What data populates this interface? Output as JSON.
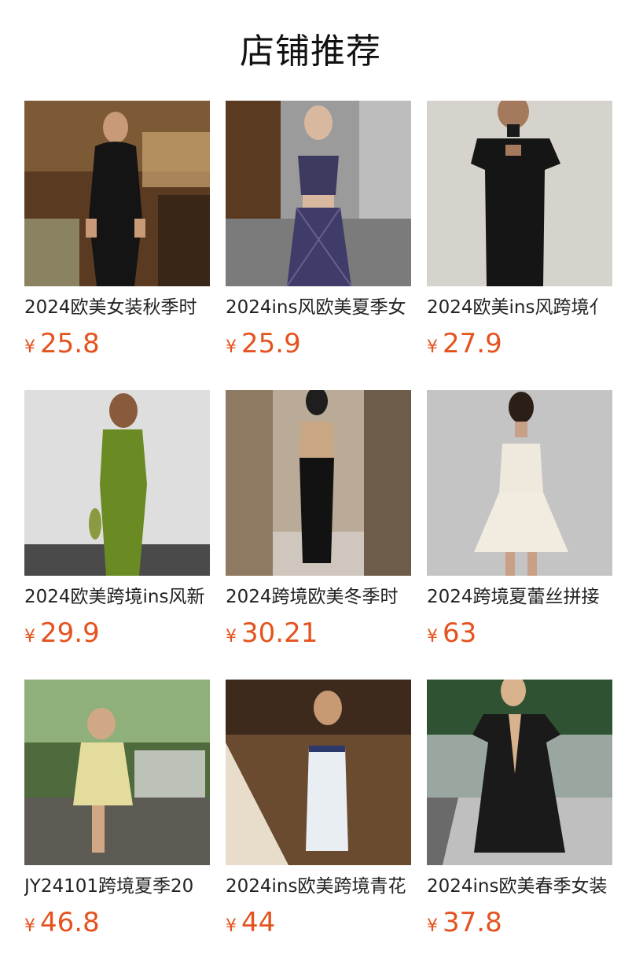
{
  "header": {
    "title": "店铺推荐"
  },
  "currency_symbol": "¥",
  "accent_color": "#e4531f",
  "products": [
    {
      "name": "2024欧美女装秋季时",
      "price": "25.8"
    },
    {
      "name": "2024ins风欧美夏季女",
      "price": "25.9"
    },
    {
      "name": "2024欧美ins风跨境亻",
      "price": "27.9"
    },
    {
      "name": "2024欧美跨境ins风新",
      "price": "29.9"
    },
    {
      "name": "2024跨境欧美冬季时",
      "price": "30.21"
    },
    {
      "name": "2024跨境夏蕾丝拼接",
      "price": "63"
    },
    {
      "name": "JY24101跨境夏季20",
      "price": "46.8"
    },
    {
      "name": "2024ins欧美跨境青花",
      "price": "44"
    },
    {
      "name": "2024ins欧美春季女装",
      "price": "37.8"
    }
  ]
}
